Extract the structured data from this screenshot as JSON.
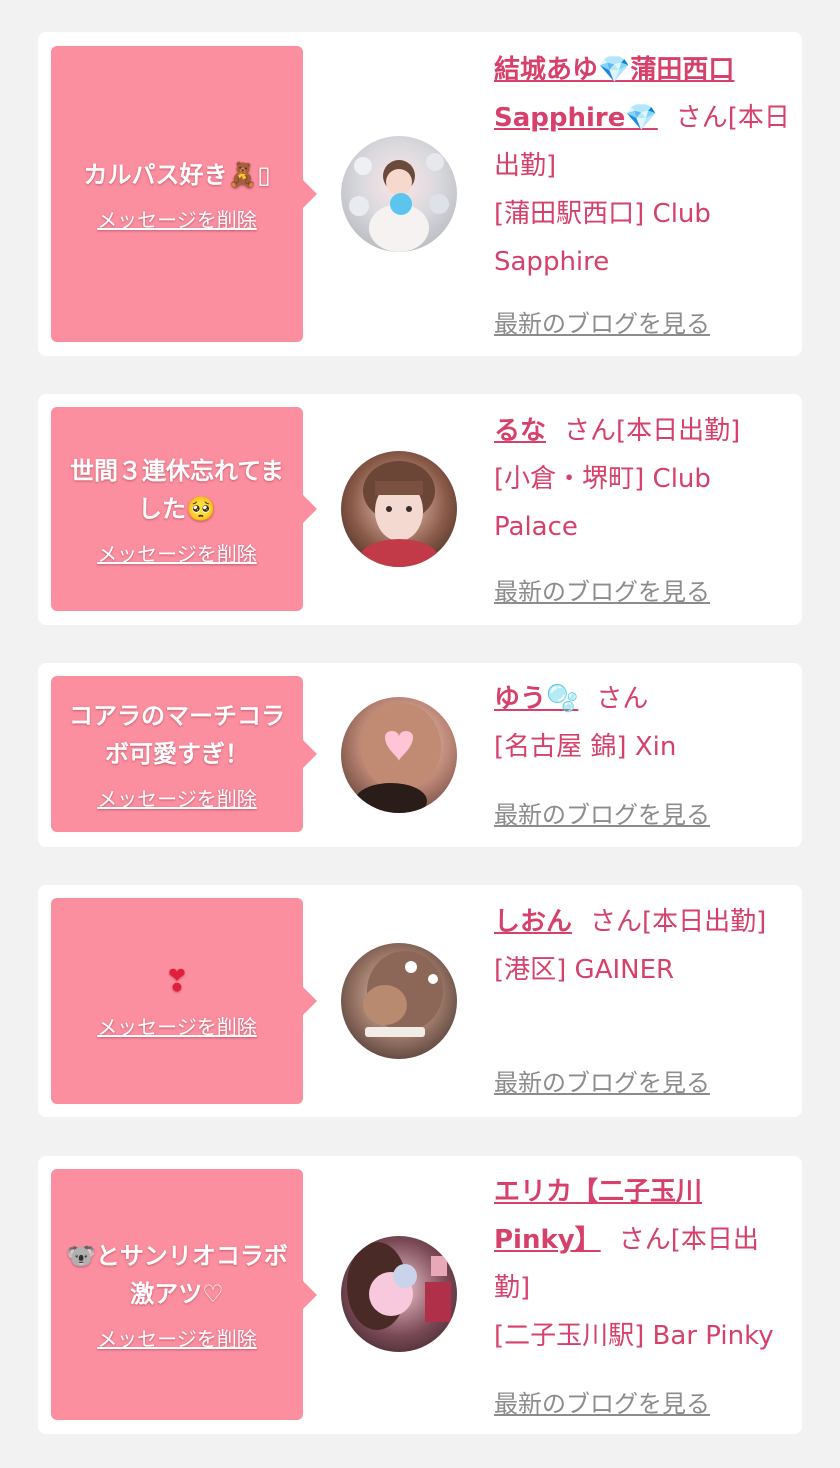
{
  "delete_label": "メッセージを削除",
  "blog_label": "最新のブログを見る",
  "cards": [
    {
      "message": "カルパス好き🧸▯",
      "name": "結城あゆ💎蒲田西口Sapphire💎",
      "suffix": "さん[本日出勤]",
      "shop": "[蒲田駅西口] Club Sapphire"
    },
    {
      "message": "世間３連休忘れてました🥺",
      "name": "るな",
      "suffix": "さん[本日出勤]",
      "shop": "[小倉・堺町] Club Palace"
    },
    {
      "message": "コアラのマーチコラボ可愛すぎ！",
      "name": "ゆう🫧",
      "suffix": "さん",
      "shop": "[名古屋 錦] Xin"
    },
    {
      "message": "❣",
      "name": "しおん",
      "suffix": "さん[本日出勤]",
      "shop": "[港区] GAINER"
    },
    {
      "message": "🐨とサンリオコラボ激アツ♡",
      "name": "エリカ【二子玉川Pinky】",
      "suffix": "さん[本日出勤]",
      "shop": "[二子玉川駅] Bar Pinky"
    }
  ]
}
